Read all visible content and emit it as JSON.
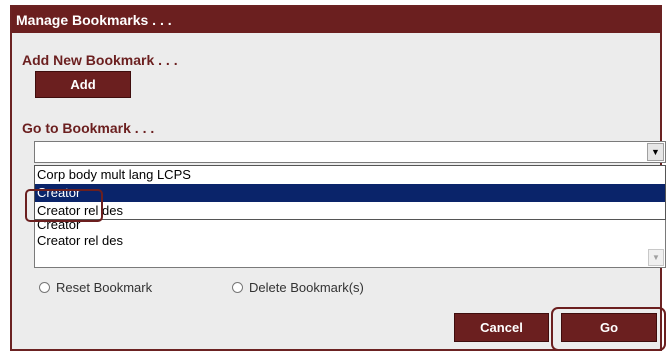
{
  "dialog": {
    "title": "Manage Bookmarks . . ."
  },
  "add_section": {
    "label": "Add New Bookmark . . .",
    "add_button": "Add"
  },
  "goto_section": {
    "label": "Go to Bookmark . . .",
    "selected_value": ""
  },
  "dropdown_options": [
    {
      "label": "Corp body mult lang LCPS",
      "selected": false
    },
    {
      "label": "Creator",
      "selected": true
    },
    {
      "label": "Creator rel des",
      "selected": false
    }
  ],
  "bookmark_list": [
    {
      "label": "Creator"
    },
    {
      "label": "Creator rel des"
    }
  ],
  "radios": {
    "reset": "Reset Bookmark",
    "delete": "Delete Bookmark(s)"
  },
  "footer": {
    "cancel": "Cancel",
    "go": "Go"
  },
  "colors": {
    "accent": "#6b1f1f",
    "selection": "#0a246a",
    "panel": "#ececec"
  },
  "icons": {
    "select_arrow": "chevron-down-icon",
    "scroll_arrow": "scroll-down-icon"
  }
}
